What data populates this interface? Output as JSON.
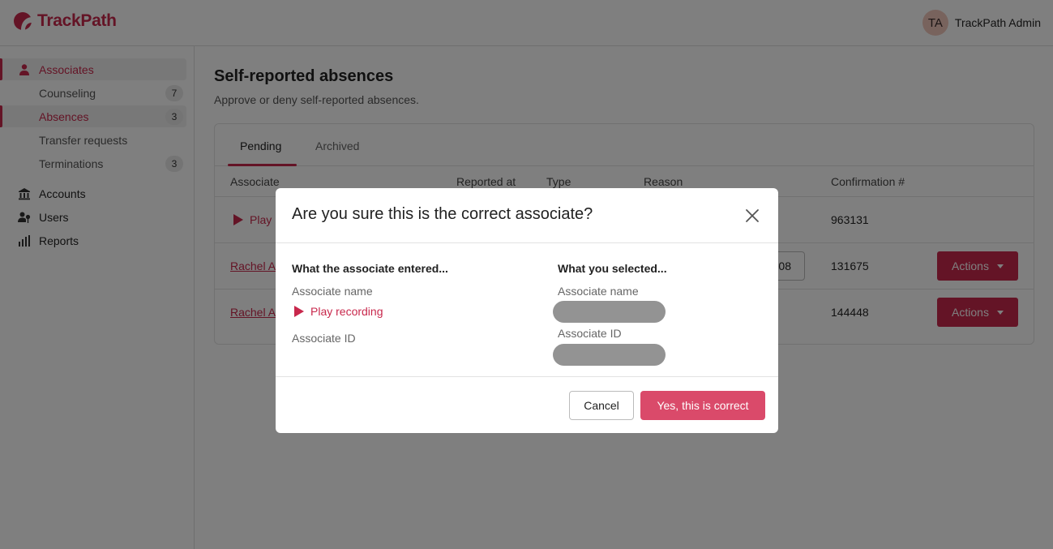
{
  "app": {
    "name": "TrackPath"
  },
  "header": {
    "user_initials": "TA",
    "user_name": "TrackPath Admin"
  },
  "sidebar": {
    "items": [
      {
        "label": "Associates",
        "icon": "person-icon",
        "active": true
      },
      {
        "label": "Counseling",
        "badge": "7"
      },
      {
        "label": "Absences",
        "badge": "3",
        "active": true
      },
      {
        "label": "Transfer requests"
      },
      {
        "label": "Terminations",
        "badge": "3"
      },
      {
        "label": "Accounts",
        "icon": "bank-icon"
      },
      {
        "label": "Users",
        "icon": "user-key-icon"
      },
      {
        "label": "Reports",
        "icon": "bar-chart-icon"
      }
    ]
  },
  "main": {
    "title": "Self-reported absences",
    "subtitle": "Approve or deny self-reported absences.",
    "tabs": [
      {
        "label": "Pending",
        "active": true
      },
      {
        "label": "Archived"
      }
    ],
    "columns": [
      "Associate",
      "Reported at",
      "Type",
      "Reason",
      "Confirmation #"
    ],
    "rows": [
      {
        "associate": "Play",
        "associate_kind": "play",
        "confirmation": "963131"
      },
      {
        "associate": "Rachel A",
        "associate_kind": "link",
        "partial_button": "08",
        "confirmation": "131675",
        "action": "Actions"
      },
      {
        "associate": "Rachel A",
        "associate_kind": "link",
        "confirmation": "144448",
        "action": "Actions"
      }
    ]
  },
  "modal": {
    "title": "Are you sure this is the correct associate?",
    "left": {
      "heading": "What the associate entered...",
      "name_label": "Associate name",
      "play_label": "Play recording",
      "id_label": "Associate ID"
    },
    "right": {
      "heading": "What you selected...",
      "name_label": "Associate name",
      "id_label": "Associate ID"
    },
    "cancel_label": "Cancel",
    "confirm_label": "Yes, this is correct"
  },
  "colors": {
    "brand": "#c8284c",
    "confirm": "#da4a6a"
  }
}
